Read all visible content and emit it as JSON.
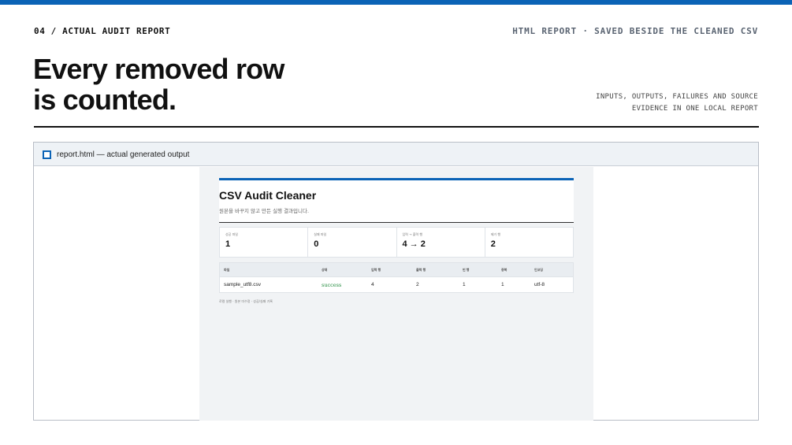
{
  "header": {
    "eyebrow": "04 / ACTUAL AUDIT REPORT",
    "eyebrow_right": "HTML REPORT · SAVED BESIDE THE CLEANED CSV",
    "headline_line1": "Every removed row",
    "headline_line2": "is counted.",
    "note_line1": "INPUTS, OUTPUTS, FAILURES AND SOURCE",
    "note_line2": "EVIDENCE IN ONE LOCAL REPORT"
  },
  "window": {
    "title": "report.html — actual generated output"
  },
  "report": {
    "title": "CSV Audit Cleaner",
    "subtitle": "원본을 바꾸지 않고 만든 실행 결과입니다.",
    "stats": [
      {
        "label": "성공 파일",
        "value": "1"
      },
      {
        "label": "실패 파일",
        "value": "0"
      },
      {
        "label": "입력 → 출력 행",
        "value": "4 → 2"
      },
      {
        "label": "제거 행",
        "value": "2"
      }
    ],
    "table": {
      "headers": [
        "파일",
        "상태",
        "입력 행",
        "출력 행",
        "빈 행",
        "중복",
        "인코딩"
      ],
      "rows": [
        [
          "sample_utf8.csv",
          "success",
          "4",
          "2",
          "1",
          "1",
          "utf-8"
        ]
      ]
    },
    "footer": "로컬 실행 · 원본 미수정 · 성공/실패 기록"
  },
  "colors": {
    "accent": "#0b63b6",
    "success": "#1f8a3b"
  }
}
